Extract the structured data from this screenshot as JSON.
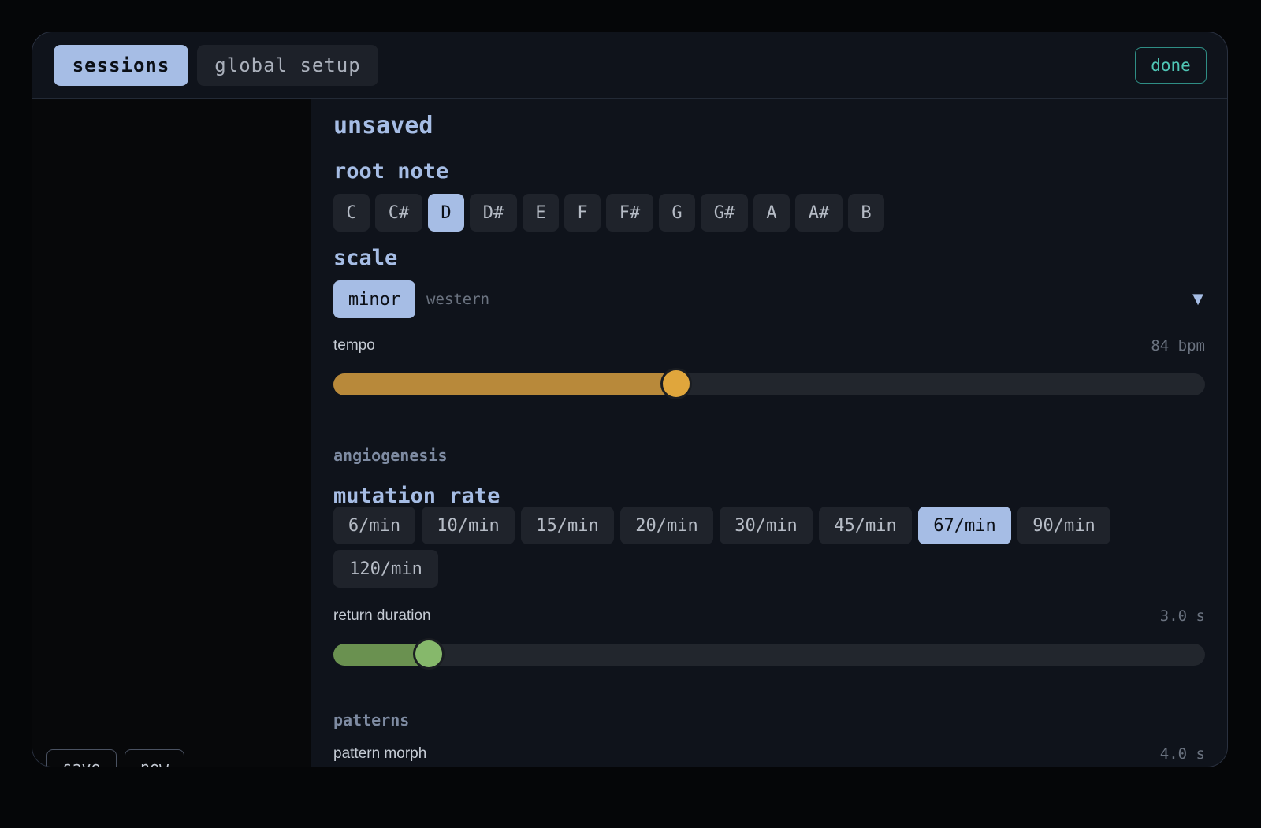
{
  "tabs": [
    {
      "label": "sessions",
      "active": true
    },
    {
      "label": "global setup",
      "active": false
    }
  ],
  "done_label": "done",
  "sidebar": {
    "save_label": "save",
    "new_label": "new"
  },
  "main": {
    "title": "unsaved",
    "root_note": {
      "heading": "root note",
      "notes": [
        "C",
        "C#",
        "D",
        "D#",
        "E",
        "F",
        "F#",
        "G",
        "G#",
        "A",
        "A#",
        "B"
      ],
      "selected": "D"
    },
    "scale": {
      "heading": "scale",
      "selected": "minor",
      "family": "western",
      "dropdown_icon": "triangle-down-icon"
    },
    "tempo": {
      "label": "tempo",
      "value_text": "84 bpm",
      "fraction": 0.393,
      "color": "#b8893a",
      "thumb_color": "#e0a63c"
    },
    "section_angiogenesis": "angiogenesis",
    "mutation_rate": {
      "heading": "mutation rate",
      "options": [
        "6/min",
        "10/min",
        "15/min",
        "20/min",
        "30/min",
        "45/min",
        "67/min",
        "90/min",
        "120/min"
      ],
      "selected": "67/min"
    },
    "return_duration": {
      "label": "return duration",
      "value_text": "3.0 s",
      "fraction": 0.109,
      "color": "#6a9150",
      "thumb_color": "#86b86b"
    },
    "section_patterns": "patterns",
    "pattern_morph": {
      "label": "pattern morph",
      "value_text": "4.0 s"
    }
  },
  "colors": {
    "accent": "#a6bde5",
    "done": "#4fc5b5"
  }
}
